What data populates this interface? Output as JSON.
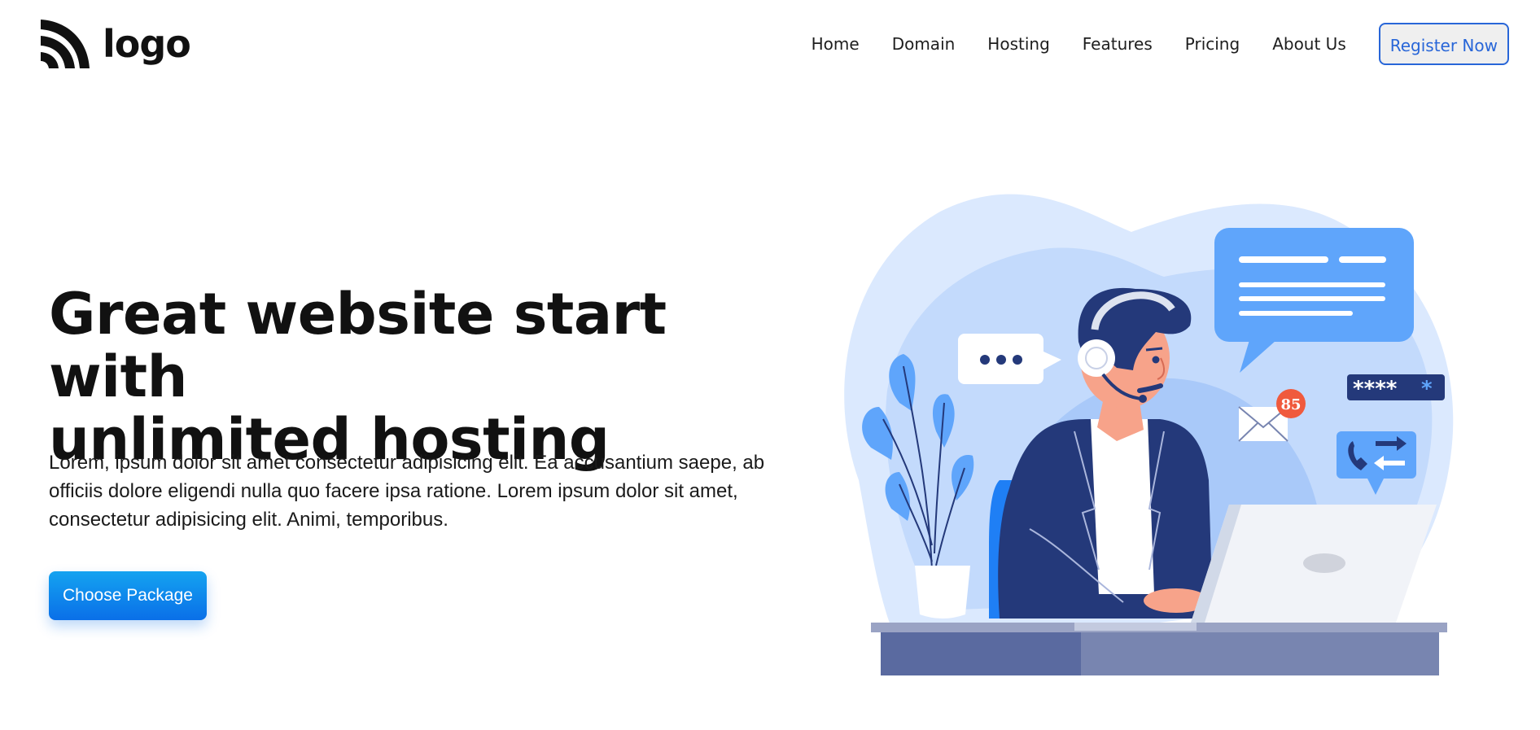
{
  "header": {
    "logo_text": "logo",
    "logo_icon": "wifi-arcs-icon",
    "nav": [
      {
        "label": "Home"
      },
      {
        "label": "Domain"
      },
      {
        "label": "Hosting"
      },
      {
        "label": "Features"
      },
      {
        "label": "Pricing"
      },
      {
        "label": "About Us"
      }
    ],
    "register_label": "Register Now"
  },
  "hero": {
    "title_line1": "Great website start with",
    "title_line2": "unlimited hosting",
    "description": "Lorem, ipsum dolor sit amet consectetur adipisicing elit. Ea accusantium saepe, ab officiis dolore eligendi nulla quo facere ipsa ratione. Lorem ipsum dolor sit amet, consectetur adipisicing elit. Animi, temporibus.",
    "cta_label": "Choose Package"
  },
  "illustration": {
    "subject": "customer-support-agent-illustration",
    "notification_count": "85",
    "password_mask": "****",
    "password_accent": "*",
    "colors": {
      "blob_light": "#dbe9fe",
      "blob_mid": "#c3dafc",
      "accent_blue": "#5fa5fb",
      "navy": "#24397a",
      "desk": "#7885b0"
    }
  },
  "colors": {
    "brand": "#2866d8",
    "cta_top": "#14a3f0",
    "cta_bottom": "#0a6fe8",
    "text": "#111111"
  }
}
